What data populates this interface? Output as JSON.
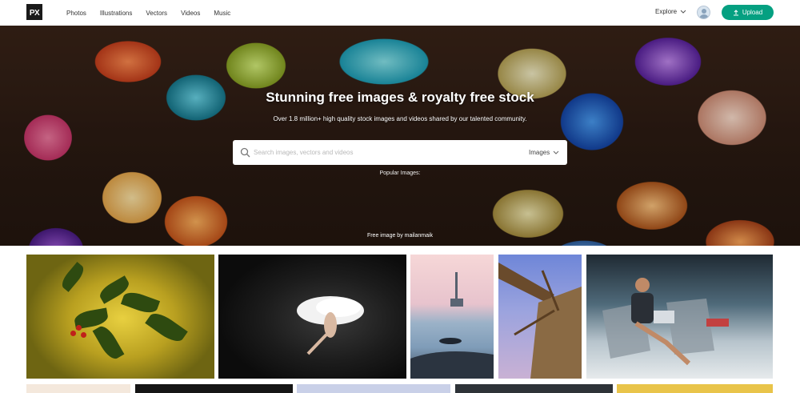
{
  "header": {
    "logo_text": "PX",
    "nav": [
      "Photos",
      "Illustrations",
      "Vectors",
      "Videos",
      "Music"
    ],
    "explore_label": "Explore",
    "upload_label": "Upload",
    "accent_color": "#05a081"
  },
  "hero": {
    "title": "Stunning free images & royalty free stock",
    "subtitle": "Over 1.8 million+ high quality stock images and videos shared by our talented community.",
    "search_placeholder": "Search images, vectors and videos",
    "search_type": "Images",
    "popular_label": "Popular Images:",
    "credit": "Free image by mailanmaik"
  },
  "icons": {
    "search": "search-icon",
    "chevron": "chevron-down-icon",
    "upload": "upload-icon",
    "avatar": "user-avatar-icon"
  }
}
